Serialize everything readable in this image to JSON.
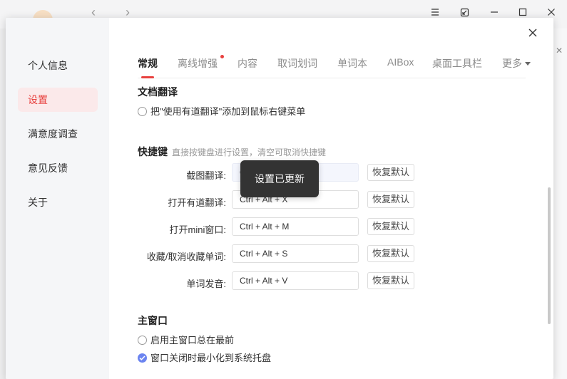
{
  "chrome": {
    "nav_back": "‹",
    "nav_forward": "›",
    "icons": [
      "menu-icon",
      "mini-window-icon",
      "minimize-icon",
      "maximize-icon",
      "close-icon"
    ]
  },
  "sidebar": {
    "items": [
      {
        "label": "个人信息"
      },
      {
        "label": "设置",
        "active": true
      },
      {
        "label": "满意度调查"
      },
      {
        "label": "意见反馈"
      },
      {
        "label": "关于"
      }
    ]
  },
  "tabs": [
    {
      "label": "常规",
      "active": true
    },
    {
      "label": "离线增强",
      "badge": true
    },
    {
      "label": "内容"
    },
    {
      "label": "取词划词"
    },
    {
      "label": "单词本"
    },
    {
      "label": "AIBox"
    },
    {
      "label": "桌面工具栏"
    },
    {
      "label": "更多"
    }
  ],
  "doc_translate": {
    "title": "文档翻译",
    "option": "把\"使用有道翻译\"添加到鼠标右键菜单",
    "checked": false
  },
  "hotkeys": {
    "title": "快捷键",
    "hint": "直接按键盘进行设置，清空可取消快捷键",
    "reset_label": "恢复默认",
    "rows": [
      {
        "label": "截图翻译:",
        "value": "Ct"
      },
      {
        "label": "打开有道翻译:",
        "value": "Ctrl + Alt + X"
      },
      {
        "label": "打开mini窗口:",
        "value": "Ctrl + Alt + M"
      },
      {
        "label": "收藏/取消收藏单词:",
        "value": "Ctrl + Alt + S"
      },
      {
        "label": "单词发音:",
        "value": "Ctrl + Alt + V"
      }
    ]
  },
  "main_window": {
    "title": "主窗口",
    "options": [
      {
        "label": "启用主窗口总在最前",
        "checked": false
      },
      {
        "label": "窗口关闭时最小化到系统托盘",
        "checked": true
      }
    ]
  },
  "toast": {
    "text": "设置已更新"
  },
  "colors": {
    "accent": "#e8413f",
    "check": "#6b84f0",
    "toast_bg": "#333333"
  }
}
